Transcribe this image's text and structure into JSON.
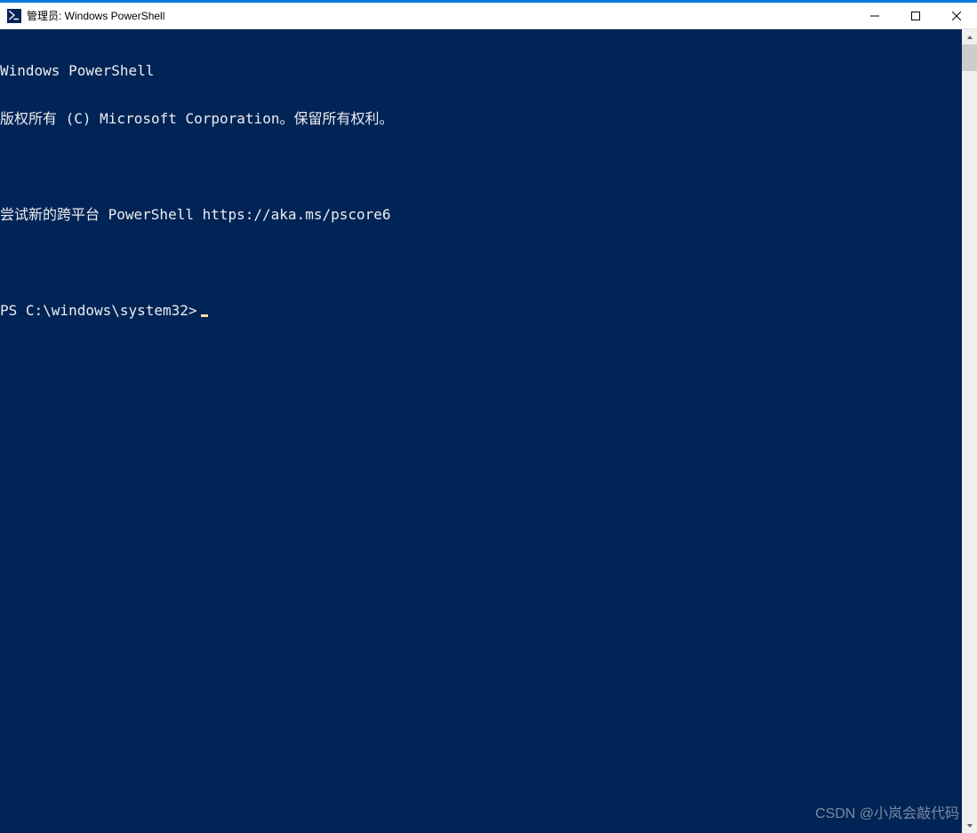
{
  "window": {
    "title": "管理员: Windows PowerShell"
  },
  "terminal": {
    "lines": [
      "Windows PowerShell",
      "版权所有 (C) Microsoft Corporation。保留所有权利。",
      "",
      "尝试新的跨平台 PowerShell https://aka.ms/pscore6",
      ""
    ],
    "prompt": "PS C:\\windows\\system32>",
    "background": "#012456",
    "foreground": "#eeedf0",
    "cursor_color": "#fedba9"
  },
  "watermark": "CSDN @小岚会敲代码"
}
